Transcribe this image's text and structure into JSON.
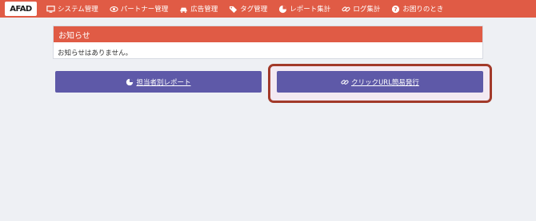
{
  "logo": {
    "text": "AFAD"
  },
  "nav": [
    {
      "label": "システム管理",
      "icon": "monitor-icon"
    },
    {
      "label": "パートナー管理",
      "icon": "eye-icon"
    },
    {
      "label": "広告管理",
      "icon": "car-icon"
    },
    {
      "label": "タグ管理",
      "icon": "tag-icon"
    },
    {
      "label": "レポート集計",
      "icon": "pie-chart-icon"
    },
    {
      "label": "ログ集計",
      "icon": "link-icon"
    },
    {
      "label": "お困りのとき",
      "icon": "question-icon"
    }
  ],
  "notice": {
    "title": "お知らせ",
    "body": "お知らせはありません。"
  },
  "buttons": {
    "report_label": "担当者別レポート",
    "report_icon": "pie-chart-icon",
    "click_url_label": "クリックURL簡易発行",
    "click_url_icon": "link-icon"
  },
  "colors": {
    "header": "#e05b45",
    "button": "#5e59a8",
    "highlight_border": "#a23a2a",
    "background": "#eef0f4"
  }
}
